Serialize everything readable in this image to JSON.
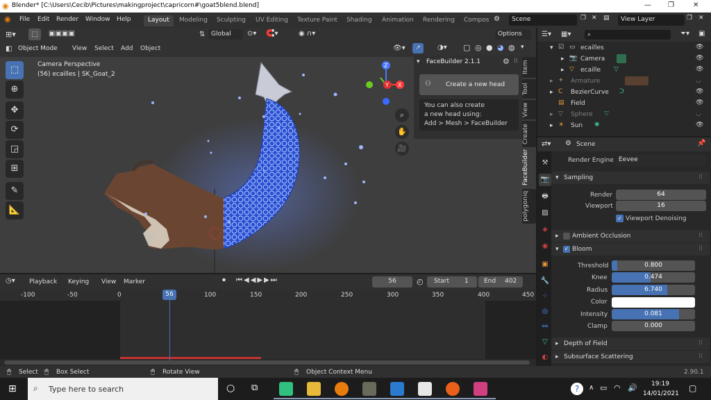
{
  "window": {
    "title": "Blender* [C:\\Users\\Cecib\\Pictures\\makingproject\\capricorn#\\goat5blend.blend]"
  },
  "menu": {
    "items": [
      "File",
      "Edit",
      "Render",
      "Window",
      "Help"
    ]
  },
  "workspaces": [
    "Layout",
    "Modeling",
    "Sculpting",
    "UV Editing",
    "Texture Paint",
    "Shading",
    "Animation",
    "Rendering",
    "Compos"
  ],
  "scene_field": "Scene",
  "view_layer_field": "View Layer",
  "toolheader": {
    "transform_orientation": "Global",
    "options_label": "Options"
  },
  "viewport_header": {
    "mode": "Object Mode",
    "menus": [
      "View",
      "Select",
      "Add",
      "Object"
    ]
  },
  "viewport": {
    "camera_label": "Camera Perspective",
    "object_label": "(56) ecailles | SK_Goat_2"
  },
  "gizmo": {
    "z": "Z",
    "y": "Y",
    "x": "X"
  },
  "facebuilder": {
    "title": "FaceBuilder 2.1.1",
    "create_button": "Create a new head",
    "info_line1": "You can also create",
    "info_line2": "a new head using:",
    "info_line3": "Add > Mesh > FaceBuilder"
  },
  "sidebar_tabs": [
    "Item",
    "Tool",
    "View",
    "Create",
    "FaceBuilder",
    "polygoniq"
  ],
  "timeline": {
    "menus": [
      "Playback",
      "Keying",
      "View",
      "Marker"
    ],
    "current_frame": "56",
    "start_label": "Start",
    "start_value": "1",
    "end_label": "End",
    "end_value": "402",
    "ruler": [
      "-100",
      "-50",
      "0",
      "56",
      "100",
      "150",
      "200",
      "250",
      "300",
      "350",
      "400",
      "450"
    ]
  },
  "outliner": {
    "rows": [
      {
        "label": "ecailles",
        "dimmed": false
      },
      {
        "label": "Camera",
        "dimmed": false
      },
      {
        "label": "ecaille",
        "dimmed": false
      },
      {
        "label": "Armature",
        "dimmed": true
      },
      {
        "label": "BezierCurve",
        "dimmed": false
      },
      {
        "label": "Field",
        "dimmed": false
      },
      {
        "label": "Sphere",
        "dimmed": true
      },
      {
        "label": "Sun",
        "dimmed": false
      }
    ]
  },
  "properties": {
    "scene_name": "Scene",
    "render_engine_label": "Render Engine",
    "render_engine": "Eevee",
    "sampling": {
      "title": "Sampling",
      "render_label": "Render",
      "render_value": "64",
      "viewport_label": "Viewport",
      "viewport_value": "16",
      "denoise_label": "Viewport Denoising"
    },
    "ambient_occlusion": "Ambient Occlusion",
    "bloom": {
      "title": "Bloom",
      "threshold_label": "Threshold",
      "threshold": "0.800",
      "threshold_fraction": 0.07,
      "knee_label": "Knee",
      "knee": "0.474",
      "knee_fraction": 0.47,
      "radius_label": "Radius",
      "radius": "6.740",
      "radius_fraction": 0.67,
      "color_label": "Color",
      "color_value": "#ffffff",
      "intensity_label": "Intensity",
      "intensity": "0.081",
      "intensity_fraction": 0.81,
      "clamp_label": "Clamp",
      "clamp": "0.000"
    },
    "depth_of_field": "Depth of Field",
    "subsurface": "Subsurface Scattering"
  },
  "statusbar": {
    "select": "Select",
    "box_select": "Box Select",
    "rotate": "Rotate View",
    "context": "Object Context Menu",
    "version": "2.90.1"
  },
  "taskbar": {
    "search_placeholder": "Type here to search",
    "time": "19:19",
    "date": "14/01/2021"
  },
  "colors": {
    "accent": "#4772b3",
    "header": "#303030",
    "viewport": "#3e3e3e",
    "timeline_range": "#c83232"
  }
}
